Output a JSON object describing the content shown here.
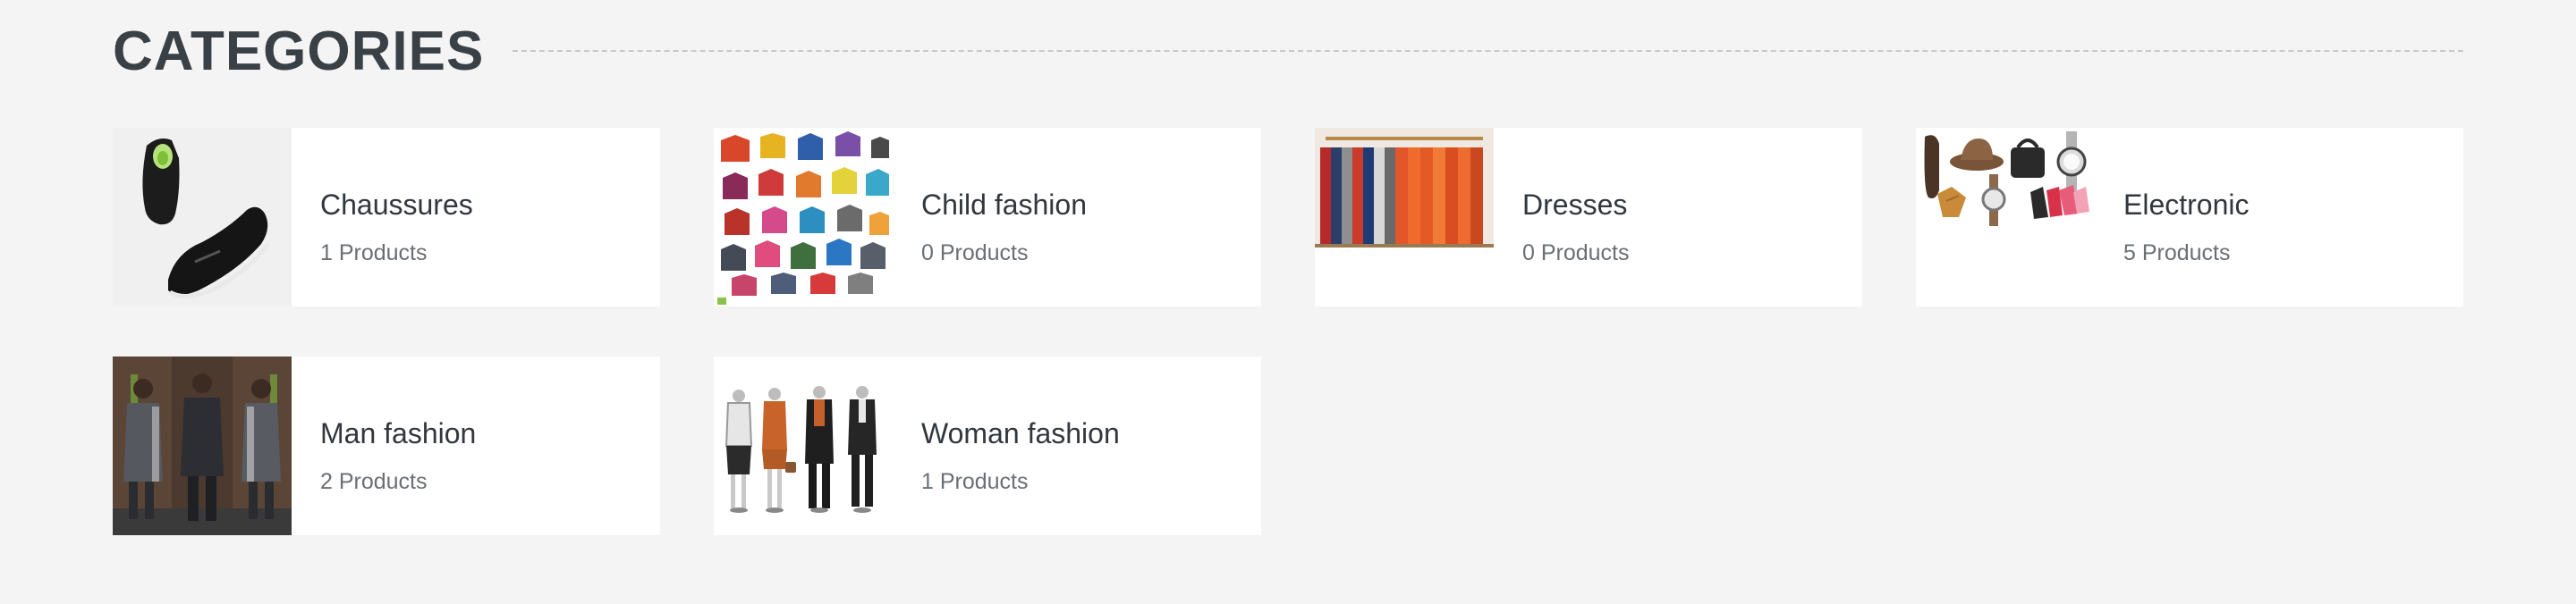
{
  "section": {
    "title": "CATEGORIES"
  },
  "categories": [
    {
      "name": "Chaussures",
      "count": "1 Products",
      "image": "shoes-thumbnail"
    },
    {
      "name": "Child fashion",
      "count": "0 Products",
      "image": "kids-jackets-thumbnail"
    },
    {
      "name": "Dresses",
      "count": "0 Products",
      "image": "clothing-rack-thumbnail"
    },
    {
      "name": "Electronic",
      "count": "5 Products",
      "image": "accessories-thumbnail"
    },
    {
      "name": "Man fashion",
      "count": "2 Products",
      "image": "men-outfit-thumbnail"
    },
    {
      "name": "Woman fashion",
      "count": "1 Products",
      "image": "mannequins-thumbnail"
    }
  ],
  "colors": {
    "background": "#f4f4f4",
    "card": "#ffffff",
    "title": "#394046",
    "name": "#31373d",
    "count": "#6a6f74"
  }
}
